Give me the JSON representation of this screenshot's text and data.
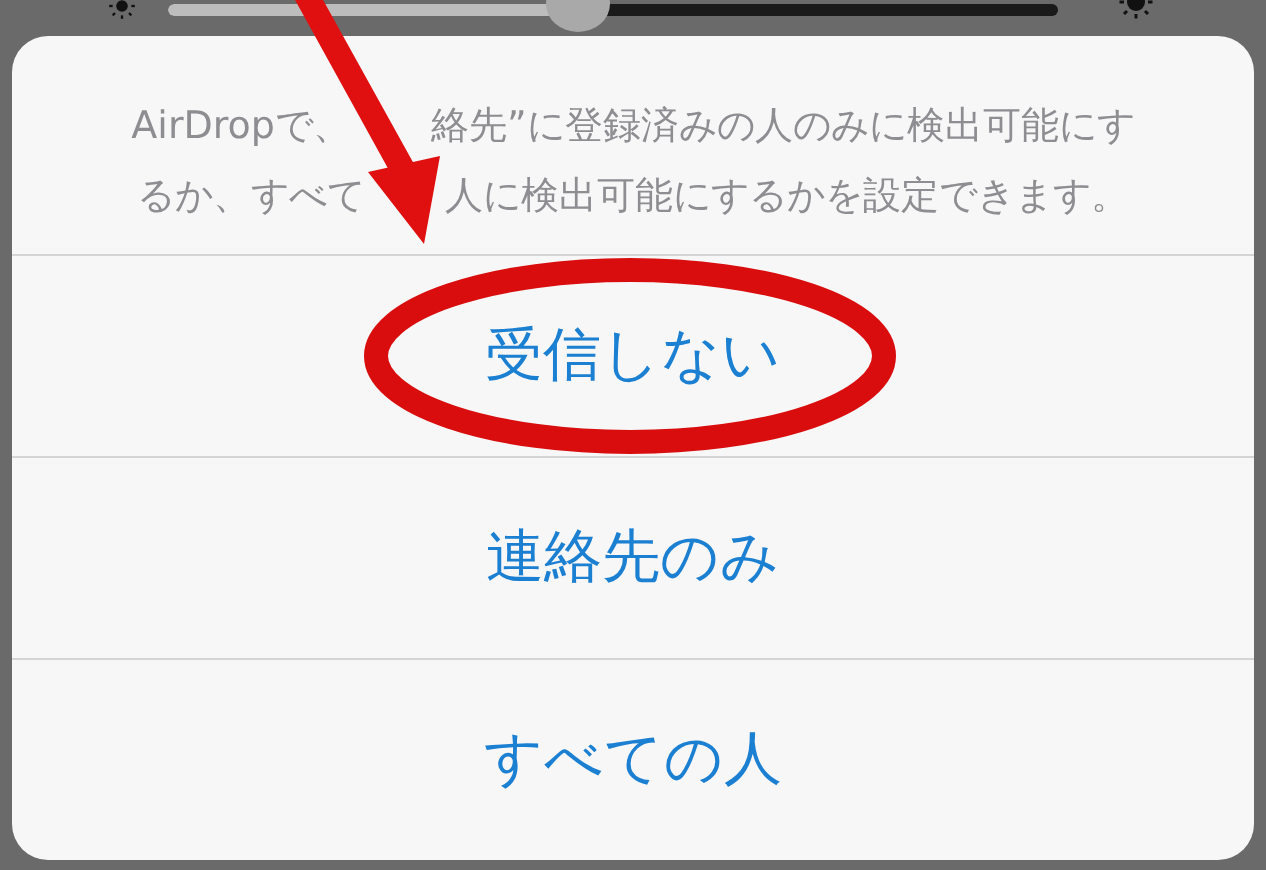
{
  "brightness": {
    "level": 0.46
  },
  "sheet": {
    "message_lines": [
      [
        "AirDropで、",
        "絡先”に登録済みの人のみに検出可能にす"
      ],
      [
        "るか、すべて",
        "人に検出可能にするかを設定できます。"
      ]
    ],
    "options": [
      {
        "label": "受信しない"
      },
      {
        "label": "連絡先のみ"
      },
      {
        "label": "すべての人"
      }
    ]
  }
}
